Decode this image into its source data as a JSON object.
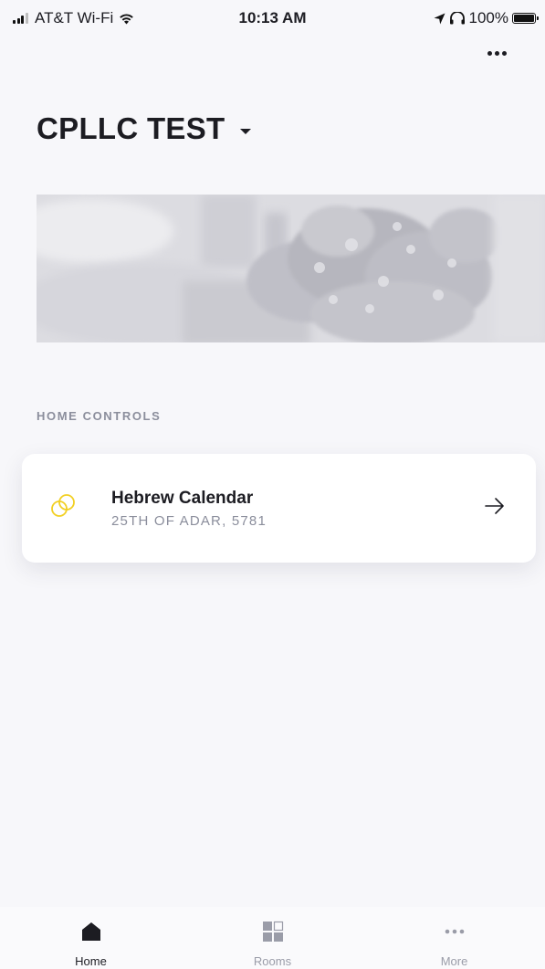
{
  "status_bar": {
    "carrier": "AT&T Wi-Fi",
    "time": "10:13 AM",
    "battery": "100%"
  },
  "header": {
    "home_name": "CPLLC TEST"
  },
  "sections": {
    "home_controls_label": "HOME CONTROLS"
  },
  "controls": [
    {
      "title": "Hebrew Calendar",
      "subtitle": "25TH OF ADAR, 5781",
      "icon": "linked-circles-icon",
      "icon_color": "#f2d024"
    }
  ],
  "tabs": [
    {
      "label": "Home",
      "icon": "home-icon",
      "active": true
    },
    {
      "label": "Rooms",
      "icon": "rooms-grid-icon",
      "active": false
    },
    {
      "label": "More",
      "icon": "more-dots-icon",
      "active": false
    }
  ],
  "colors": {
    "background": "#f7f7fa",
    "text_primary": "#1c1c22",
    "text_secondary": "#8b8e9c",
    "accent_yellow": "#f2d024"
  }
}
